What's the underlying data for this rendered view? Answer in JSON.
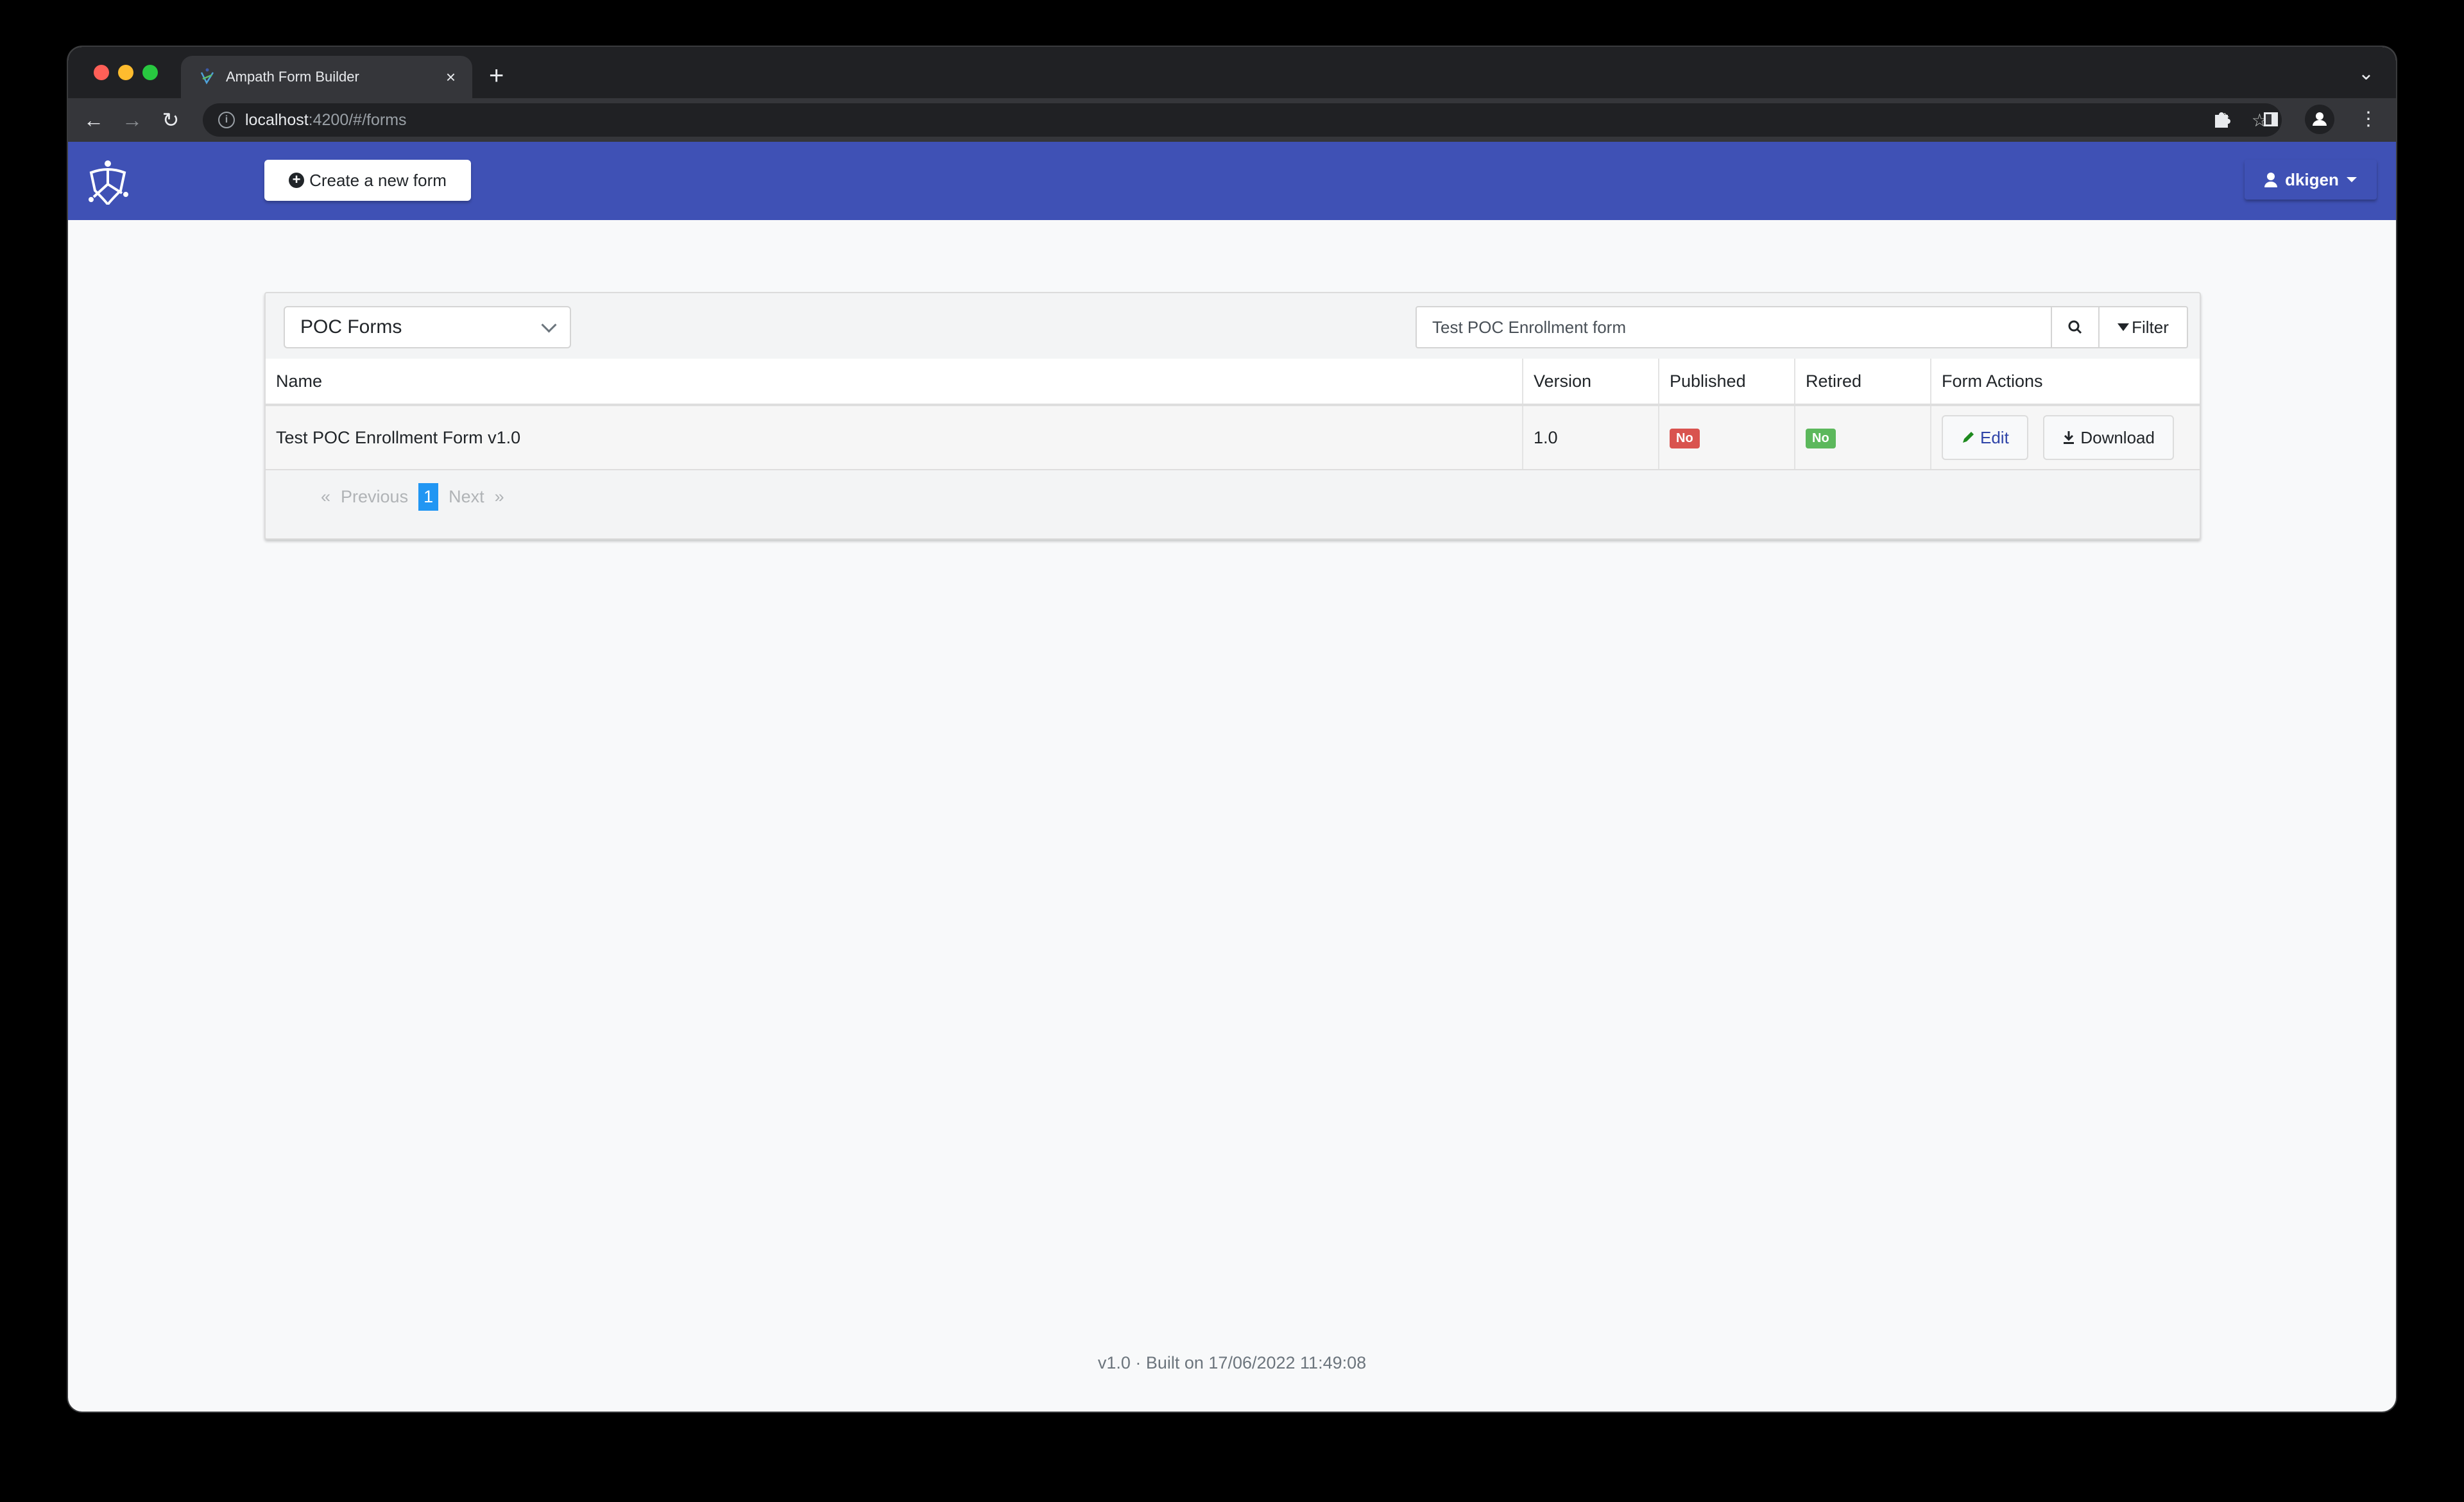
{
  "browser": {
    "tab_title": "Ampath Form Builder",
    "new_tab_label": "+",
    "url_host": "localhost",
    "url_rest": ":4200/#/forms",
    "traffic_lights": {
      "close": "#ff5f57",
      "minimize": "#febc2e",
      "zoom": "#28c840"
    }
  },
  "header": {
    "brand_color": "#3f51b5",
    "create_button_label": "Create a new form",
    "user_name": "dkigen"
  },
  "panel": {
    "category_select_value": "POC Forms",
    "search_value": "Test POC Enrollment form",
    "filter_label": "Filter",
    "table": {
      "columns": [
        "Name",
        "Version",
        "Published",
        "Retired",
        "Form Actions"
      ],
      "rows": [
        {
          "name": "Test POC Enrollment Form v1.0",
          "version": "1.0",
          "published": "No",
          "retired": "No",
          "actions": {
            "edit": "Edit",
            "download": "Download"
          }
        }
      ]
    },
    "pagination": {
      "prev_symbol": "«",
      "prev_label": "Previous",
      "current_page": "1",
      "next_label": "Next",
      "next_symbol": "»"
    }
  },
  "status_colors": {
    "published_no": "#d9534f",
    "retired_no": "#5cb85c"
  },
  "footer": {
    "build_info": "v1.0 · Built on 17/06/2022 11:49:08"
  }
}
